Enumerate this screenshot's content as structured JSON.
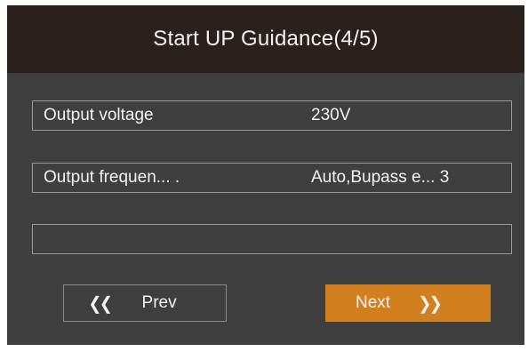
{
  "dialog": {
    "title": "Start UP Guidance(4/5)"
  },
  "fields": [
    {
      "label": "Output voltage",
      "value": "230V"
    },
    {
      "label": "Output frequen... .",
      "value": "Auto,Bupass e... 3"
    },
    {
      "label": "",
      "value": ""
    }
  ],
  "buttons": {
    "prev": {
      "label": "Prev",
      "icon": "double-chevron-left-icon",
      "glyph": "《"
    },
    "next": {
      "label": "Next",
      "icon": "double-chevron-right-icon",
      "glyph": "》"
    }
  },
  "colors": {
    "title_background": "#2b211c",
    "panel_background": "#3f3f3f",
    "accent": "#d27f1f",
    "text": "#f2f2f2"
  }
}
